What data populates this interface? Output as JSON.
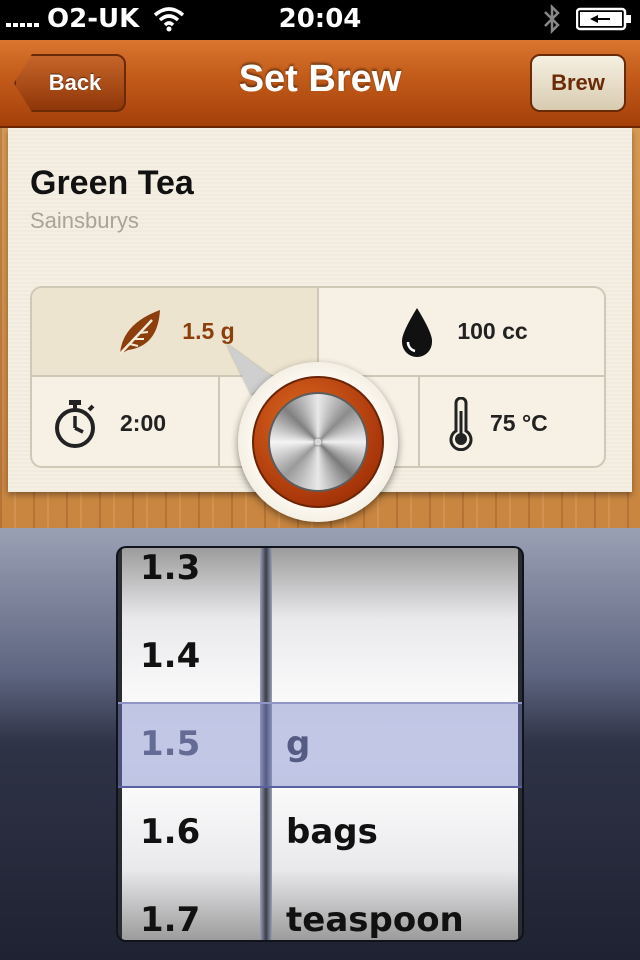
{
  "status_bar": {
    "carrier": "O2-UK",
    "time": "20:04"
  },
  "nav": {
    "back_label": "Back",
    "title": "Set Brew",
    "brew_label": "Brew"
  },
  "tea": {
    "name": "Green Tea",
    "brand": "Sainsburys"
  },
  "settings": {
    "weight": "1.5 g",
    "water": "100 cc",
    "time": "2:00",
    "temperature": "75 °C"
  },
  "picker": {
    "numbers": [
      "1.3",
      "1.4",
      "1.5",
      "1.6",
      "1.7"
    ],
    "units": [
      "",
      "",
      "g",
      "bags",
      "teaspoon"
    ],
    "selected_number": "1.5",
    "selected_unit": "g"
  },
  "colors": {
    "accent": "#8c3e0d",
    "nav": "#c15a19"
  }
}
